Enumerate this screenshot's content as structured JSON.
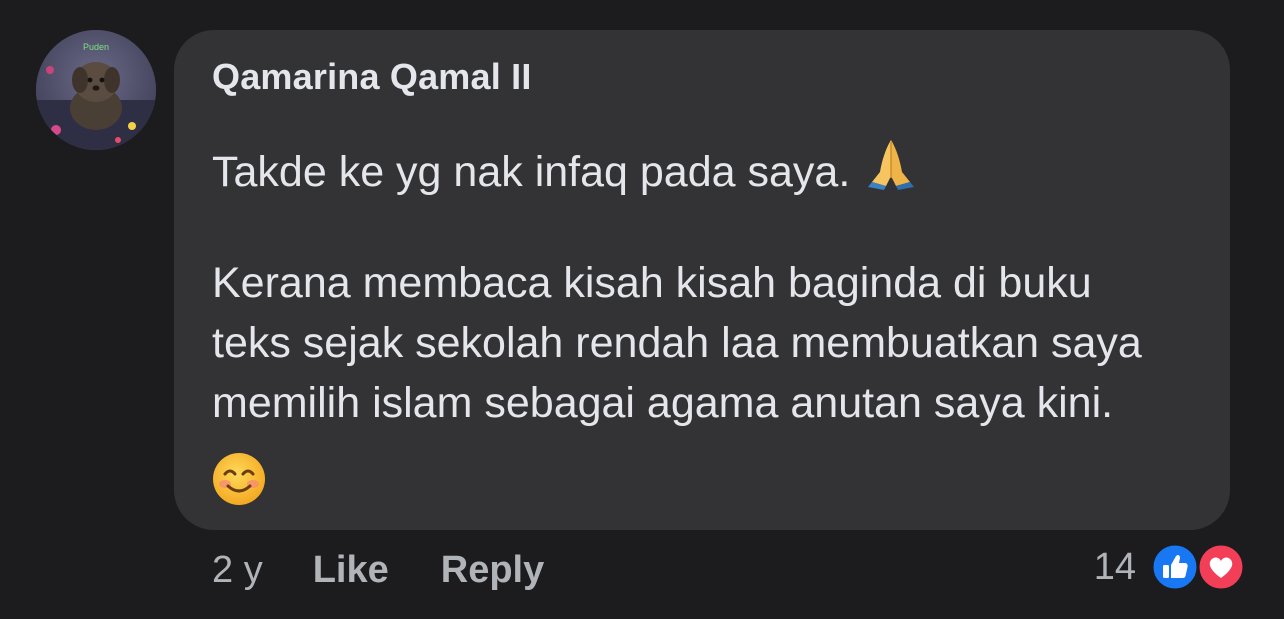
{
  "comment": {
    "author": "Qamarina Qamal II",
    "avatar_label": "Puden",
    "lines": [
      "Takde ke yg nak infaq pada saya.",
      "Kerana membaca kisah kisah baginda di buku",
      "teks sejak sekolah rendah laa membuatkan saya",
      "memilih islam sebagai agama anutan saya kini."
    ],
    "inline_emoji": "folded-hands-emoji",
    "trailing_emoji": "smiling-face-emoji"
  },
  "actions": {
    "time": "2 y",
    "like_label": "Like",
    "reply_label": "Reply"
  },
  "reactions": {
    "count": "14",
    "types": [
      "like-icon",
      "love-icon"
    ]
  },
  "colors": {
    "background": "#1c1c1e",
    "bubble": "#333335",
    "text": "#e4e6eb",
    "secondary_text": "#b0b3b8",
    "like_blue": "#1877f2",
    "love_red": "#f33e58"
  }
}
